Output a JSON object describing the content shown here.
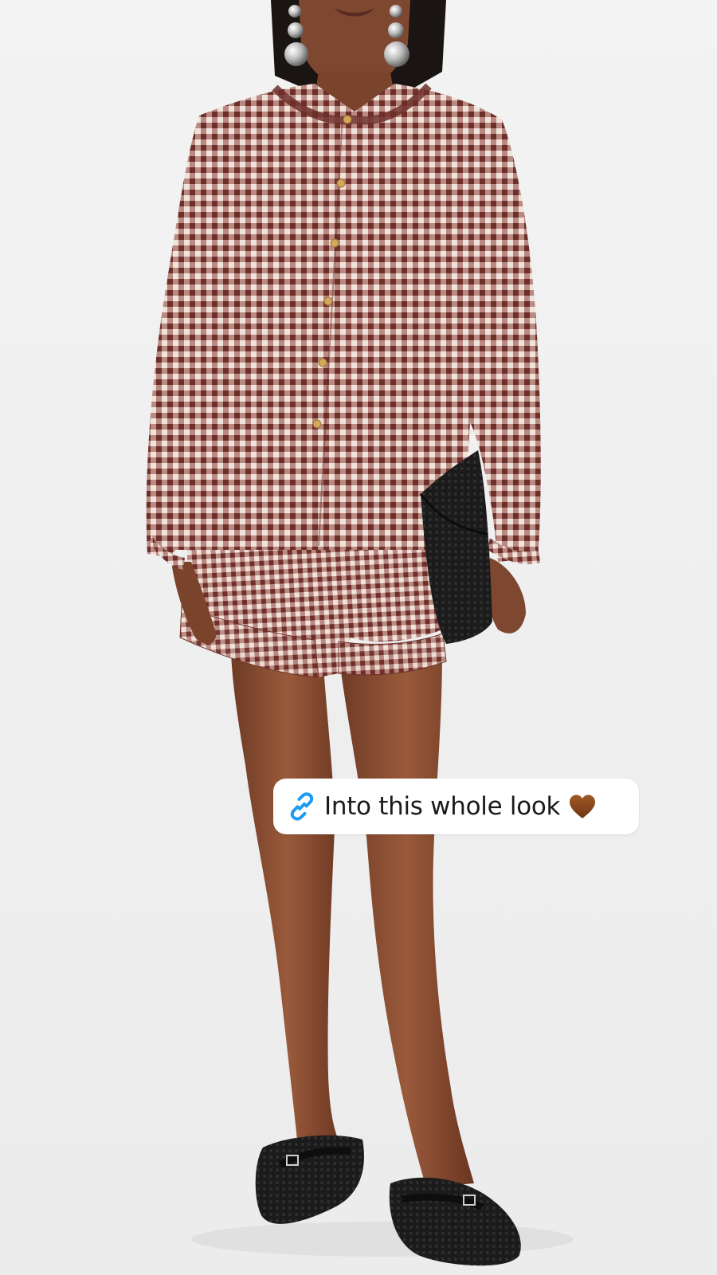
{
  "sticker": {
    "text": "Into this whole look",
    "link_icon": "link-icon",
    "emoji_icon": "brown-heart-icon"
  },
  "colors": {
    "background": "#f1f1f1",
    "sticker_bg": "#ffffff",
    "link_blue": "#1d9bf0",
    "heart_brown": "#8b4a1c",
    "gingham_dark": "#7a3b35",
    "gingham_light": "#efe4dc",
    "skin": "#8a4f33",
    "black_items": "#151515"
  }
}
